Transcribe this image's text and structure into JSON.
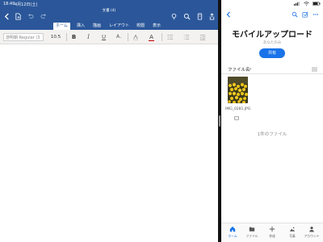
{
  "word": {
    "status": {
      "time": "18:49",
      "date": "4月12日(土)"
    },
    "doc_title": "文書 (4)",
    "tabs": [
      {
        "label": "ホーム",
        "active": true
      },
      {
        "label": "挿入",
        "active": false
      },
      {
        "label": "描画",
        "active": false
      },
      {
        "label": "レイアウト",
        "active": false
      },
      {
        "label": "校閲",
        "active": false
      },
      {
        "label": "表示",
        "active": false
      }
    ],
    "ribbon": {
      "font_name": "游明朝 Regular (3",
      "font_size": "10.5",
      "bold": "B",
      "italic": "I",
      "underline": "U",
      "font_color": "A",
      "highlight": "A"
    },
    "icons": [
      "back-icon",
      "document-icon",
      "undo-icon",
      "redo-icon",
      "lightbulb-icon",
      "search-icon",
      "mobile-view-icon",
      "share-icon"
    ]
  },
  "onedrive": {
    "folder_title": "モバイルアップロード",
    "folder_subtitle": "あなたのみ",
    "share_label": "共有",
    "sort_label": "ファイル名",
    "sort_chevron": "⌄",
    "files": [
      {
        "name": "IMG_0281.JPG"
      }
    ],
    "file_count": "1件のファイル",
    "nav": [
      {
        "label": "ホーム",
        "icon": "home-icon",
        "active": true
      },
      {
        "label": "ファイル",
        "icon": "folder-icon",
        "active": false
      },
      {
        "label": "作成",
        "icon": "plus-icon",
        "active": false
      },
      {
        "label": "写真",
        "icon": "photos-icon",
        "active": false
      },
      {
        "label": "アカウント",
        "icon": "person-icon",
        "active": false
      }
    ]
  },
  "colors": {
    "word_blue": "#2b579a",
    "accent_blue": "#1a73e8",
    "divider": "#111111"
  }
}
